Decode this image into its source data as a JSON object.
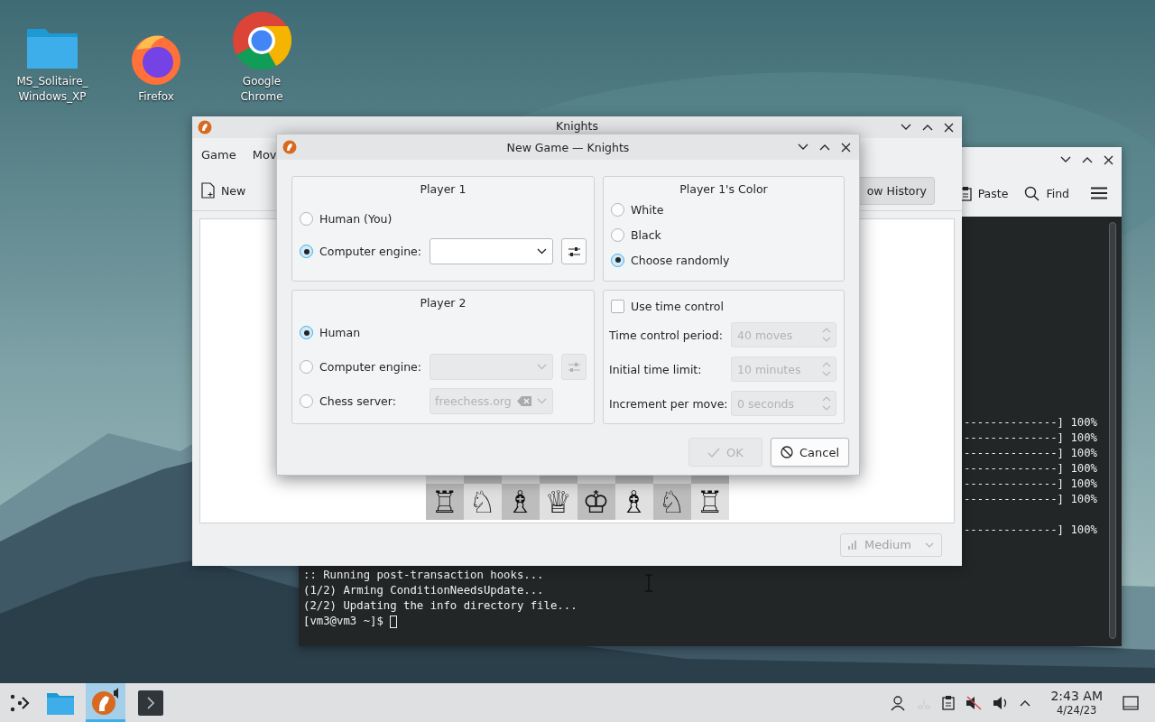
{
  "desktop_icons": [
    {
      "kind": "folder",
      "label": "MS_Solitaire_ Windows_XP"
    },
    {
      "kind": "firefox",
      "label": "Firefox"
    },
    {
      "kind": "chrome",
      "label": "Google Chrome"
    }
  ],
  "terminal": {
    "toolbar": [
      {
        "kind": "paste",
        "label": "Paste"
      },
      {
        "kind": "find",
        "label": "Find"
      }
    ],
    "progress_groups": [
      [
        "--------------] 100%",
        "--------------] 100%",
        "--------------] 100%",
        "--------------] 100%",
        "--------------] 100%",
        "--------------] 100%"
      ],
      [
        "--------------] 100%"
      ]
    ],
    "lines": [
      ":: Running post-transaction hooks...",
      "(1/2) Arming ConditionNeedsUpdate...",
      "(2/2) Updating the info directory file...",
      "[vm3@vm3 ~]$ "
    ]
  },
  "knights": {
    "title": "Knights",
    "menu": [
      "Game",
      "Mov"
    ],
    "new_label": "New",
    "history_label": "ow History",
    "pieces": [
      "♖",
      "♘",
      "♗",
      "♕",
      "♔",
      "♗",
      "♘",
      "♖"
    ],
    "difficulty": "Medium"
  },
  "dialog": {
    "title": "New Game — Knights",
    "player1": {
      "title": "Player 1",
      "options": [
        {
          "kind": "plain",
          "label": "Human (You)",
          "selected": false
        },
        {
          "kind": "engine",
          "label": "Computer engine:",
          "selected": true,
          "control_disabled": false
        }
      ]
    },
    "color": {
      "title": "Player 1's Color",
      "options": [
        {
          "label": "White",
          "selected": false
        },
        {
          "label": "Black",
          "selected": false
        },
        {
          "label": "Choose randomly",
          "selected": true
        }
      ]
    },
    "player2": {
      "title": "Player 2",
      "options": [
        {
          "kind": "plain",
          "label": "Human",
          "selected": true
        },
        {
          "kind": "engine",
          "label": "Computer engine:",
          "selected": false,
          "control_disabled": true
        },
        {
          "kind": "server",
          "label": "Chess server:",
          "selected": false,
          "control_disabled": true,
          "value": "freechess.org"
        }
      ]
    },
    "time": {
      "label": "Use time control",
      "checked": false,
      "fields": [
        {
          "label": "Time control period:",
          "value": "40 moves",
          "disabled": true
        },
        {
          "label": "Initial time limit:",
          "value": "10 minutes",
          "disabled": true
        },
        {
          "label": "Increment per move:",
          "value": "0 seconds",
          "disabled": true
        }
      ]
    },
    "buttons": [
      {
        "kind": "ok",
        "label": "OK",
        "disabled": true
      },
      {
        "kind": "cancel",
        "label": "Cancel",
        "disabled": false
      }
    ]
  },
  "taskbar": {
    "apps": [
      {
        "kind": "files",
        "selected": false
      },
      {
        "kind": "knights",
        "selected": true
      },
      {
        "kind": "terminal",
        "selected": false
      }
    ],
    "time": "2:43 AM",
    "date": "4/24/23"
  }
}
